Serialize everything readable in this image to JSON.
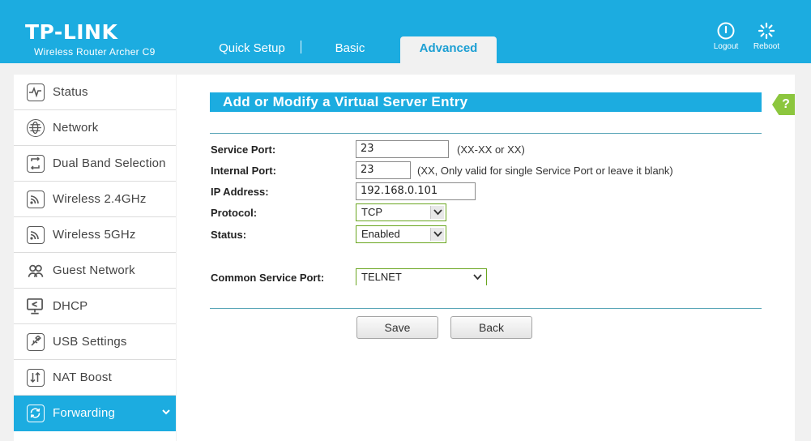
{
  "header": {
    "brand": "TP-LINK",
    "model": "Wireless Router Archer C9",
    "tabs": [
      {
        "label": "Quick Setup"
      },
      {
        "label": "Basic"
      },
      {
        "label": "Advanced"
      }
    ],
    "active_tab": "Advanced",
    "logout_label": "Logout",
    "reboot_label": "Reboot",
    "bg_color": "#1cace0"
  },
  "sidebar": {
    "items": [
      {
        "label": "Status",
        "icon": "pulse-icon"
      },
      {
        "label": "Network",
        "icon": "globe-icon"
      },
      {
        "label": "Dual Band Selection",
        "icon": "dual-arrow-icon"
      },
      {
        "label": "Wireless 2.4GHz",
        "icon": "wifi-icon"
      },
      {
        "label": "Wireless 5GHz",
        "icon": "wifi-icon"
      },
      {
        "label": "Guest Network",
        "icon": "users-icon"
      },
      {
        "label": "DHCP",
        "icon": "monitor-network-icon"
      },
      {
        "label": "USB Settings",
        "icon": "usb-icon"
      },
      {
        "label": "NAT Boost",
        "icon": "nat-boost-icon"
      },
      {
        "label": "Forwarding",
        "icon": "forwarding-icon"
      }
    ],
    "active": "Forwarding",
    "active_color": "#1cace0"
  },
  "form": {
    "title": "Add or Modify a Virtual Server Entry",
    "help_label": "?",
    "service_port": {
      "label": "Service Port:",
      "value": "23",
      "hint": "(XX-XX or XX)"
    },
    "internal_port": {
      "label": "Internal Port:",
      "value": "23",
      "hint": "(XX, Only valid for single Service Port or leave it blank)"
    },
    "ip_address": {
      "label": "IP Address:",
      "value": "192.168.0.101"
    },
    "protocol": {
      "label": "Protocol:",
      "value": "TCP"
    },
    "status": {
      "label": "Status:",
      "value": "Enabled"
    },
    "common_service_port": {
      "label": "Common Service Port:",
      "value": "TELNET"
    },
    "save_label": "Save",
    "back_label": "Back"
  }
}
